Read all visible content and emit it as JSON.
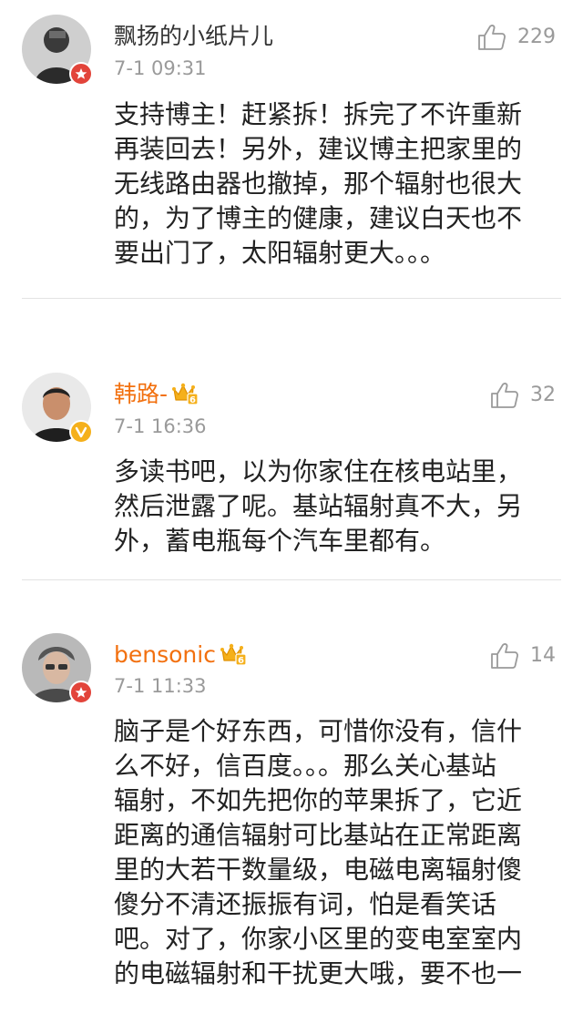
{
  "comments": [
    {
      "user": "飘扬的小纸片儿",
      "time": "7-1 09:31",
      "likes": "229",
      "text": "支持博主！赶紧拆！拆完了不许重新\n再装回去！另外，建议博主把家里的\n无线路由器也撤掉，那个辐射也很大\n的，为了博主的健康，建议白天也不\n要出门了，太阳辐射更大。。。",
      "badge": "red-badge-icon",
      "vip": false
    },
    {
      "user": "韩路-",
      "time": "7-1 16:36",
      "likes": "32",
      "text": "多读书吧，以为你家住在核电站里，\n然后泄露了呢。基站辐射真不大，另\n外，蓄电瓶每个汽车里都有。",
      "badge": "verified-v-icon",
      "vip": true,
      "vip_level": "6"
    },
    {
      "user": "bensonic",
      "time": "7-1 11:33",
      "likes": "14",
      "text": "脑子是个好东西，可惜你没有，信什\n么不好，信百度。。。那么关心基站\n辐射，不如先把你的苹果拆了，它近\n距离的通信辐射可比基站在正常距离\n里的大若干数量级，电磁电离辐射傻\n傻分不清还振振有词，怕是看笑话\n吧。对了，你家小区里的变电室室内\n的电磁辐射和干扰更大哦，要不也一",
      "badge": "red-badge-icon",
      "vip": true,
      "vip_level": "6"
    }
  ],
  "colors": {
    "vip_name": "#f2700f",
    "badge_red": "#e2443a",
    "badge_gold": "#f5b01b"
  }
}
